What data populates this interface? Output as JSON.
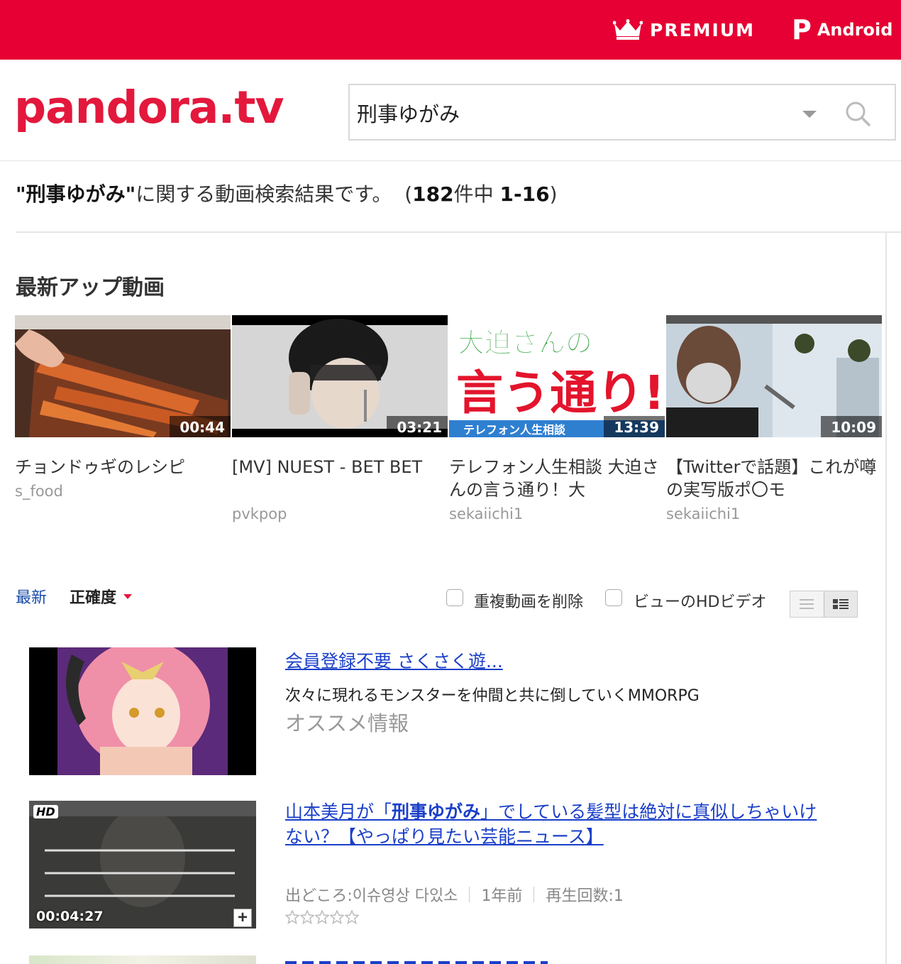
{
  "topbar": {
    "premium_label": "PREMIUM",
    "android_label": "Android",
    "brand_color": "#e60033"
  },
  "header": {
    "logo": "pandora.tv",
    "search_value": "刑事ゆがみ"
  },
  "summary": {
    "query": "\"刑事ゆがみ\"",
    "text": "に関する動画検索結果です。",
    "open": "(",
    "total": "182",
    "middle": "件中",
    "range": "1-16",
    "close": ")"
  },
  "latest": {
    "title": "最新アップ動画",
    "videos": [
      {
        "duration": "00:44",
        "title": "チョンドゥギのレシピ",
        "user": "s_food"
      },
      {
        "duration": "03:21",
        "title": "[MV] NUEST - BET BET",
        "user": "pvkpop"
      },
      {
        "duration": "13:39",
        "title": "テレフォン人生相談 大迫さんの言う通り！大",
        "user": "sekaiichi1"
      },
      {
        "duration": "10:09",
        "title": "【Twitterで話題】これが噂の実写版ポ〇モ",
        "user": "sekaiichi1"
      }
    ],
    "thumb3_text": [
      "大迫さんの",
      "言う通り!",
      "テレフォン人生相談"
    ]
  },
  "sortbar": {
    "latest": "最新",
    "accuracy": "正確度",
    "dedupe_label": "重複動画を削除",
    "hd_label": "ビューのHDビデオ"
  },
  "results": [
    {
      "title": "会員登録不要 さくさく遊...",
      "description": "次々に現れるモンスターを仲間と共に倒していくMMORPG",
      "source_label": "オススメ情報"
    },
    {
      "title_pre": "山本美月が「",
      "title_highlight": "刑事ゆがみ",
      "title_post": "」でしている髪型は絶対に真似しちゃいけない？【やっぱり見たい芸能ニュース】",
      "duration": "00:04:27",
      "hd_badge": "HD",
      "source": "出どころ:이슈영상 다있소",
      "age": "1年前",
      "views": "再生回数:1",
      "rating": 0
    }
  ]
}
